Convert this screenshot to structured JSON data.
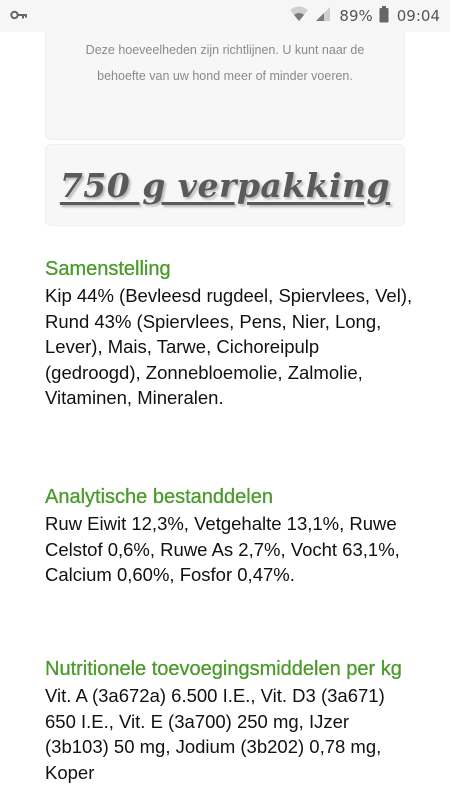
{
  "status_bar": {
    "battery_percent": "89%",
    "time": "09:04",
    "icons": [
      "key-icon",
      "wifi-icon",
      "signal-icon",
      "battery-icon"
    ]
  },
  "note": {
    "text": "Deze hoeveelheden zijn richtlijnen. U kunt naar de behoefte van uw hond meer of minder voeren."
  },
  "package": {
    "title": "750 g verpakking"
  },
  "composition": {
    "heading": "Samenstelling",
    "text": "Kip 44% (Bevleesd rugdeel, Spiervlees, Vel), Rund 43% (Spiervlees, Pens, Nier, Long, Lever), Mais, Tarwe, Cichoreipulp (gedroogd), Zonnebloemolie, Zalmolie, Vitaminen, Mineralen."
  },
  "analytic": {
    "heading": "Analytische bestanddelen",
    "text": "Ruw Eiwit 12,3%, Vetgehalte 13,1%, Ruwe Celstof 0,6%, Ruwe As 2,7%, Vocht 63,1%, Calcium 0,60%, Fosfor 0,47%."
  },
  "additives": {
    "heading": "Nutritionele toevoegingsmiddelen per kg",
    "text": "Vit. A (3a672a) 6.500 I.E., Vit. D3 (3a671) 650 I.E., Vit. E (3a700) 250 mg, IJzer (3b103) 50 mg, Jodium (3b202) 0,78 mg, Koper"
  },
  "colors": {
    "accent_green": "#4a9b2b",
    "card_bg": "#f7f7f7",
    "note_text": "#8a8a8a"
  }
}
